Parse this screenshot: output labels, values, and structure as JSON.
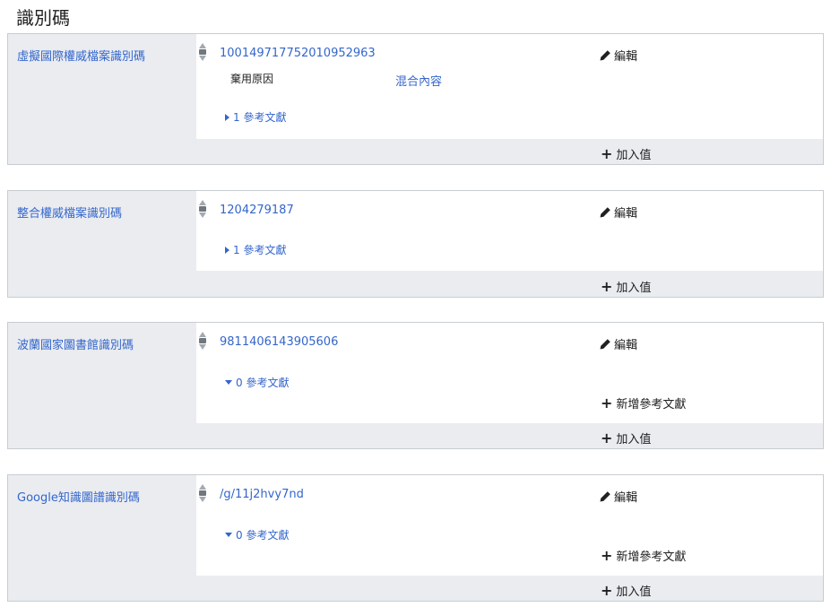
{
  "section": {
    "title": "識別碼"
  },
  "labels": {
    "edit": "編輯",
    "add_value": "加入值",
    "add_reference": "新增參考文獻"
  },
  "statements": [
    {
      "property": "虛擬國際權威檔案識別碼",
      "value": "100149717752010952963",
      "qualifier": {
        "property": "棄用原因",
        "value": "混合內容"
      },
      "references": "1 參考文獻"
    },
    {
      "property": "整合權威檔案識別碼",
      "value": "1204279187",
      "references": "1 參考文獻"
    },
    {
      "property": "波蘭國家圖書館識別碼",
      "value": "9811406143905606",
      "references": "0 參考文獻"
    },
    {
      "property": "Google知識圖譜識別碼",
      "value": "/g/11j2hvy7nd",
      "references": "0 參考文獻"
    }
  ]
}
